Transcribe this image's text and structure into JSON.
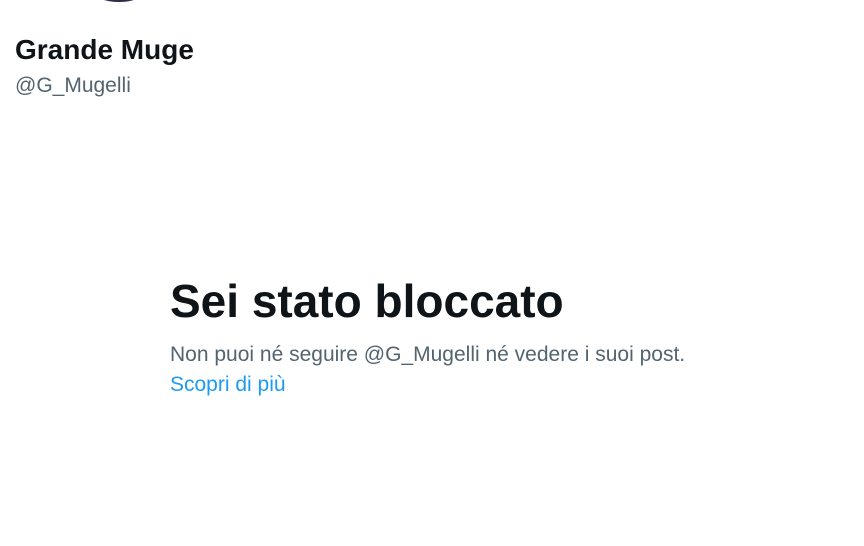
{
  "profile": {
    "name": "Grande Muge",
    "handle": "@G_Mugelli"
  },
  "blocked": {
    "title": "Sei stato bloccato",
    "message": "Non puoi né seguire @G_Mugelli né vedere i suoi post.",
    "learn_more": "Scopri di più"
  },
  "colors": {
    "text_primary": "#0f1419",
    "text_secondary": "#536471",
    "link": "#1d9bf0",
    "background": "#ffffff"
  }
}
